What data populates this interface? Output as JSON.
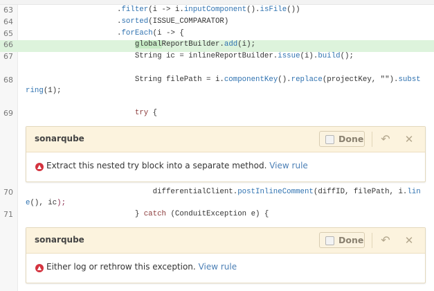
{
  "code_lines": [
    {
      "num": "63",
      "tokens": [
        [
          "                    ."
        ],
        [
          "filter",
          "m"
        ],
        [
          "(i -> i."
        ],
        [
          "inputComponent",
          "m"
        ],
        [
          "()."
        ],
        [
          "isFile",
          "m"
        ],
        [
          "())"
        ]
      ]
    },
    {
      "num": "64",
      "tokens": [
        [
          "                    ."
        ],
        [
          "sorted",
          "m"
        ],
        [
          "(ISSUE_COMPARATOR)"
        ]
      ]
    },
    {
      "num": "65",
      "tokens": [
        [
          "                    ."
        ],
        [
          "forEach",
          "m"
        ],
        [
          "(i -> {"
        ]
      ]
    },
    {
      "num": "66",
      "tokens": [
        [
          "                        "
        ],
        [
          "global",
          "mark"
        ],
        [
          "ReportBuilder."
        ],
        [
          "add",
          "m"
        ],
        [
          "(i);"
        ]
      ]
    },
    {
      "num": "67",
      "tokens": [
        [
          "                        String ic = inlineReportBuilder."
        ],
        [
          "issue",
          "m"
        ],
        [
          "(i)."
        ],
        [
          "build",
          "m"
        ],
        [
          "();"
        ]
      ]
    },
    {
      "num": "68",
      "tokens": [
        [
          "                        String filePath = i."
        ],
        [
          "componentKey",
          "m"
        ],
        [
          "()."
        ],
        [
          "replace",
          "m"
        ],
        [
          "(projectKey, \"\")."
        ],
        [
          "subst",
          "m"
        ]
      ]
    },
    {
      "num": "",
      "tokens": [
        [
          "ring",
          "m"
        ],
        [
          "(1);"
        ]
      ]
    },
    {
      "num": "69",
      "tokens": [
        [
          "                        "
        ],
        [
          "try",
          "k"
        ],
        [
          " {"
        ]
      ]
    },
    {
      "num": "70",
      "tokens": [
        [
          "                            differentialClient."
        ],
        [
          "postInlineComment",
          "m"
        ],
        [
          "(diffID, filePath, i."
        ],
        [
          "lin",
          "m"
        ]
      ]
    },
    {
      "num": "",
      "tokens": [
        [
          "e",
          "m"
        ],
        [
          "(), ic"
        ],
        [
          ");",
          "p"
        ]
      ]
    },
    {
      "num": "71",
      "tokens": [
        [
          "                        } "
        ],
        [
          "catch",
          "k"
        ],
        [
          " (ConduitException e) {"
        ]
      ]
    }
  ],
  "issues": [
    {
      "source": "sonarqube",
      "done_label": "Done",
      "message": "Extract this nested try block into a separate method.",
      "link": "View rule"
    },
    {
      "source": "sonarqube",
      "done_label": "Done",
      "message": "Either log or rethrow this exception.",
      "link": "View rule"
    }
  ],
  "colors": {
    "highlight": "#ddf3dc",
    "issue_header": "#fcf3de",
    "severity": "#d4333f",
    "link": "#4b7fb5"
  }
}
